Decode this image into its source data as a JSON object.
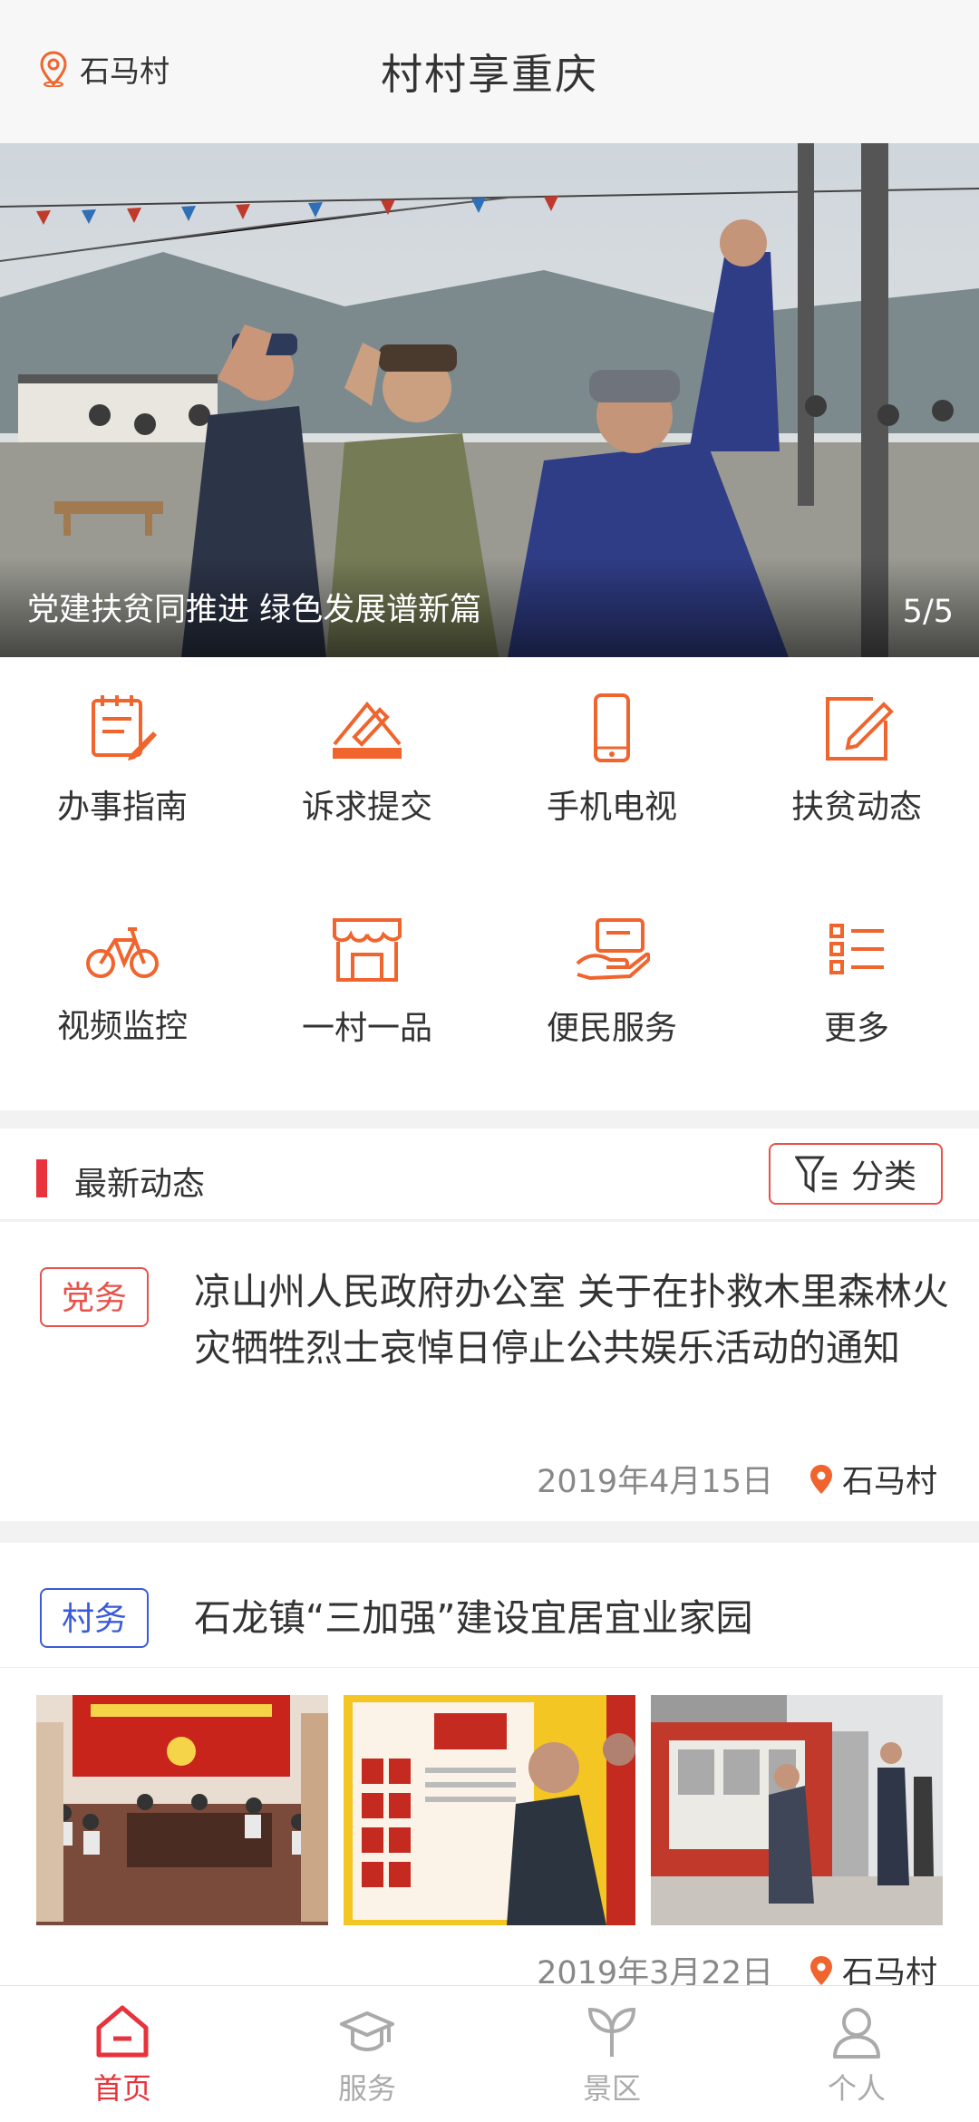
{
  "header": {
    "location": "石马村",
    "title": "村村享重庆"
  },
  "banner": {
    "caption": "党建扶贫同推进 绿色发展谱新篇",
    "counter": "5/5"
  },
  "grid": [
    {
      "label": "办事指南",
      "icon": "guide-icon"
    },
    {
      "label": "诉求提交",
      "icon": "submit-icon"
    },
    {
      "label": "手机电视",
      "icon": "mobile-tv-icon"
    },
    {
      "label": "扶贫动态",
      "icon": "edit-icon"
    },
    {
      "label": "视频监控",
      "icon": "bicycle-icon"
    },
    {
      "label": "一村一品",
      "icon": "store-icon"
    },
    {
      "label": "便民服务",
      "icon": "hand-card-icon"
    },
    {
      "label": "更多",
      "icon": "list-icon"
    }
  ],
  "section": {
    "title": "最新动态",
    "filter_label": "分类"
  },
  "news": [
    {
      "tag": "党务",
      "title": "凉山州人民政府办公室 关于在扑救木里森林火灾牺牲烈士哀悼日停止公共娱乐活动的通知",
      "date": "2019年4月15日",
      "location": "石马村"
    },
    {
      "tag": "村务",
      "title": "石龙镇“三加强”建设宜居宜业家园",
      "date": "2019年3月22日",
      "location": "石马村"
    }
  ],
  "tabs": [
    {
      "label": "首页",
      "active": true
    },
    {
      "label": "服务",
      "active": false
    },
    {
      "label": "景区",
      "active": false
    },
    {
      "label": "个人",
      "active": false
    }
  ],
  "colors": {
    "accent": "#e8524a",
    "icon_orange": "#f0642e",
    "tag_blue": "#3a5bd9",
    "inactive": "#aaaaaa"
  }
}
